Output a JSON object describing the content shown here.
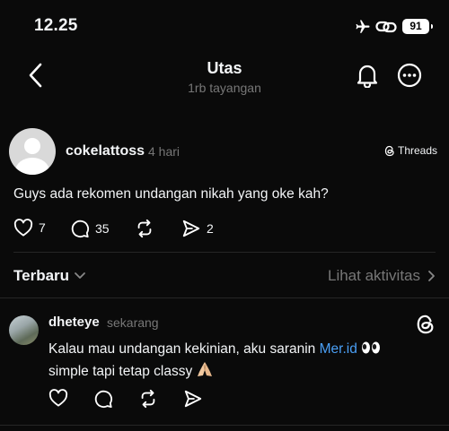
{
  "status_bar": {
    "time": "12.25",
    "battery": "91"
  },
  "header": {
    "title": "Utas",
    "subtitle": "1rb tayangan"
  },
  "post": {
    "username": "cokelattoss",
    "time_ago": "4 hari",
    "badge": "Threads",
    "text": "Guys ada rekomen undangan nikah yang oke kah?",
    "likes": "7",
    "replies": "35",
    "shares": "2"
  },
  "sort_bar": {
    "sort_label": "Terbaru",
    "activity_label": "Lihat aktivitas"
  },
  "reply": {
    "username": "dheteye",
    "time_ago": "sekarang",
    "text_before": "Kalau mau undangan kekinian, aku saranin ",
    "mention": "Mer.id",
    "text_line2": "simple tapi tetap classy"
  },
  "colors": {
    "background": "#0a0a0a",
    "text": "#f3f5f7",
    "muted": "#777777",
    "mention": "#4a9ff5",
    "divider": "#262626"
  },
  "icons": [
    "back-icon",
    "bell-icon",
    "more-icon",
    "threads-icon",
    "heart-icon",
    "comment-icon",
    "repost-icon",
    "send-icon",
    "chevron-down-icon",
    "chevron-right-icon",
    "airplane-icon",
    "link-icon",
    "battery-icon"
  ]
}
